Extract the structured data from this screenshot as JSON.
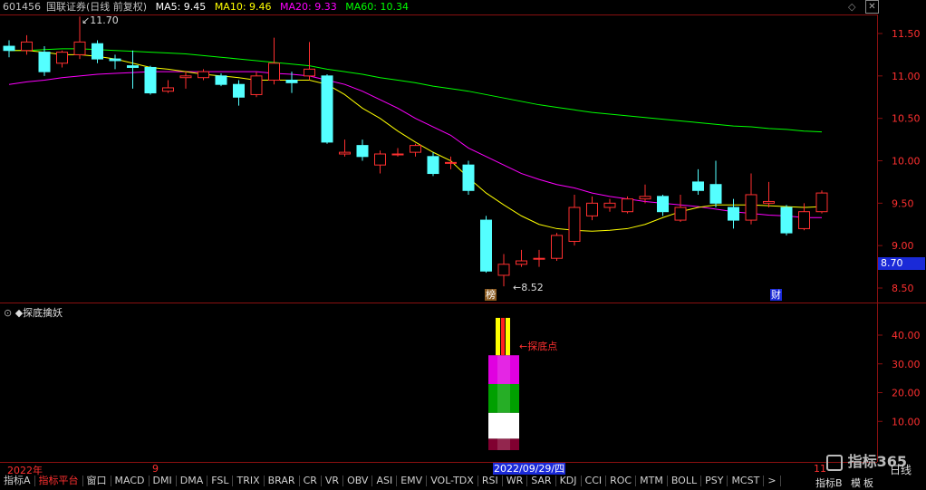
{
  "header": {
    "symbol": "601456",
    "name": "国联证券(日线 前复权)",
    "ma5_label": "MA5: 9.45",
    "ma10_label": "MA10: 9.46",
    "ma20_label": "MA20: 9.33",
    "ma60_label": "MA60: 10.34"
  },
  "colors": {
    "up": "#ff3030",
    "down": "#54ffff",
    "ma5": "#ffffff",
    "ma10": "#ffff00",
    "ma20": "#ff00ff",
    "ma60": "#00ff00",
    "axis": "#8a1010"
  },
  "price_axis": {
    "ticks": [
      "11.50",
      "11.00",
      "10.50",
      "10.00",
      "9.50",
      "9.00",
      "8.50"
    ],
    "current_price": "8.70"
  },
  "annotations": {
    "high": "11.70",
    "low": "8.52",
    "marker_bang": "榜",
    "marker_cai": "财"
  },
  "indicator": {
    "title": "◆探底擒妖",
    "signal_label": "探底点",
    "ticks": [
      "40.00",
      "30.00",
      "20.00",
      "10.00"
    ]
  },
  "time_axis": {
    "year": "2022年",
    "month": "9",
    "cursor_date": "2022/09/29/四",
    "right": "11"
  },
  "tabs": [
    "指标A",
    "指标平台",
    "窗口",
    "MACD",
    "DMI",
    "DMA",
    "FSL",
    "TRIX",
    "BRAR",
    "CR",
    "VR",
    "OBV",
    "ASI",
    "EMV",
    "VOL-TDX",
    "RSI",
    "WR",
    "SAR",
    "KDJ",
    "CCI",
    "ROC",
    "MTM",
    "BOLL",
    "PSY",
    "MCST",
    ">"
  ],
  "side_buttons": {
    "indicator_b": "指标B",
    "template": "模",
    "board": "板",
    "period": "日线"
  },
  "brand": "指标365",
  "chart_data": {
    "type": "candlestick",
    "candles": [
      {
        "o": 11.35,
        "c": 11.3,
        "h": 11.42,
        "l": 11.22
      },
      {
        "o": 11.3,
        "c": 11.4,
        "h": 11.48,
        "l": 11.25
      },
      {
        "o": 11.28,
        "c": 11.05,
        "h": 11.35,
        "l": 11.0
      },
      {
        "o": 11.15,
        "c": 11.28,
        "h": 11.3,
        "l": 11.1
      },
      {
        "o": 11.25,
        "c": 11.4,
        "h": 11.7,
        "l": 11.2
      },
      {
        "o": 11.38,
        "c": 11.2,
        "h": 11.42,
        "l": 11.15
      },
      {
        "o": 11.2,
        "c": 11.18,
        "h": 11.25,
        "l": 11.08
      },
      {
        "o": 11.12,
        "c": 11.1,
        "h": 11.3,
        "l": 10.85
      },
      {
        "o": 11.1,
        "c": 10.8,
        "h": 11.12,
        "l": 10.78
      },
      {
        "o": 10.82,
        "c": 10.86,
        "h": 10.95,
        "l": 10.8
      },
      {
        "o": 10.98,
        "c": 11.0,
        "h": 11.05,
        "l": 10.85
      },
      {
        "o": 10.98,
        "c": 11.05,
        "h": 11.08,
        "l": 10.95
      },
      {
        "o": 11.0,
        "c": 10.9,
        "h": 11.03,
        "l": 10.88
      },
      {
        "o": 10.9,
        "c": 10.75,
        "h": 10.95,
        "l": 10.65
      },
      {
        "o": 10.78,
        "c": 11.0,
        "h": 11.05,
        "l": 10.75
      },
      {
        "o": 10.95,
        "c": 11.15,
        "h": 11.45,
        "l": 10.9
      },
      {
        "o": 10.95,
        "c": 10.92,
        "h": 11.05,
        "l": 10.8
      },
      {
        "o": 11.0,
        "c": 11.08,
        "h": 11.4,
        "l": 10.95
      },
      {
        "o": 11.0,
        "c": 10.22,
        "h": 11.02,
        "l": 10.2
      },
      {
        "o": 10.08,
        "c": 10.1,
        "h": 10.25,
        "l": 10.05
      },
      {
        "o": 10.18,
        "c": 10.05,
        "h": 10.25,
        "l": 10.0
      },
      {
        "o": 9.95,
        "c": 10.08,
        "h": 10.12,
        "l": 9.85
      },
      {
        "o": 10.08,
        "c": 10.08,
        "h": 10.15,
        "l": 10.05
      },
      {
        "o": 10.1,
        "c": 10.18,
        "h": 10.2,
        "l": 10.05
      },
      {
        "o": 10.05,
        "c": 9.85,
        "h": 10.1,
        "l": 9.82
      },
      {
        "o": 9.98,
        "c": 9.98,
        "h": 10.05,
        "l": 9.9
      },
      {
        "o": 9.95,
        "c": 9.65,
        "h": 10.0,
        "l": 9.6
      },
      {
        "o": 9.3,
        "c": 8.7,
        "h": 9.35,
        "l": 8.68
      },
      {
        "o": 8.65,
        "c": 8.78,
        "h": 8.9,
        "l": 8.52
      },
      {
        "o": 8.78,
        "c": 8.82,
        "h": 8.95,
        "l": 8.75
      },
      {
        "o": 8.85,
        "c": 8.85,
        "h": 8.95,
        "l": 8.75
      },
      {
        "o": 8.85,
        "c": 9.12,
        "h": 9.15,
        "l": 8.82
      },
      {
        "o": 9.05,
        "c": 9.45,
        "h": 9.6,
        "l": 9.0
      },
      {
        "o": 9.35,
        "c": 9.5,
        "h": 9.58,
        "l": 9.3
      },
      {
        "o": 9.45,
        "c": 9.5,
        "h": 9.55,
        "l": 9.4
      },
      {
        "o": 9.4,
        "c": 9.55,
        "h": 9.58,
        "l": 9.38
      },
      {
        "o": 9.55,
        "c": 9.58,
        "h": 9.72,
        "l": 9.5
      },
      {
        "o": 9.58,
        "c": 9.4,
        "h": 9.6,
        "l": 9.35
      },
      {
        "o": 9.3,
        "c": 9.45,
        "h": 9.6,
        "l": 9.28
      },
      {
        "o": 9.75,
        "c": 9.65,
        "h": 9.9,
        "l": 9.6
      },
      {
        "o": 9.72,
        "c": 9.5,
        "h": 10.0,
        "l": 9.45
      },
      {
        "o": 9.45,
        "c": 9.3,
        "h": 9.55,
        "l": 9.2
      },
      {
        "o": 9.3,
        "c": 9.6,
        "h": 9.85,
        "l": 9.25
      },
      {
        "o": 9.5,
        "c": 9.52,
        "h": 9.75,
        "l": 9.45
      },
      {
        "o": 9.45,
        "c": 9.15,
        "h": 9.48,
        "l": 9.12
      },
      {
        "o": 9.2,
        "c": 9.4,
        "h": 9.5,
        "l": 9.18
      },
      {
        "o": 9.4,
        "c": 9.62,
        "h": 9.65,
        "l": 9.38
      }
    ],
    "ma5": [
      11.35,
      11.33,
      11.3,
      11.28,
      11.3,
      11.25,
      11.2,
      11.15,
      11.05,
      10.98,
      10.95,
      10.92,
      10.92,
      10.93,
      10.95,
      10.95,
      10.95,
      10.98,
      10.85,
      10.6,
      10.35,
      10.2,
      10.1,
      10.08,
      10.02,
      9.95,
      9.7,
      9.4,
      9.15,
      8.95,
      8.9,
      8.98,
      9.05,
      9.15,
      9.25,
      9.35,
      9.45,
      9.5,
      9.48,
      9.45,
      9.42,
      9.38,
      9.4,
      9.42,
      9.4,
      9.4,
      9.45
    ],
    "ma10": [
      11.3,
      11.3,
      11.28,
      11.25,
      11.25,
      11.23,
      11.2,
      11.15,
      11.1,
      11.08,
      11.05,
      11.02,
      11.0,
      10.98,
      10.95,
      10.95,
      10.95,
      10.95,
      10.9,
      10.78,
      10.62,
      10.5,
      10.35,
      10.22,
      10.1,
      10.0,
      9.8,
      9.62,
      9.48,
      9.35,
      9.25,
      9.2,
      9.18,
      9.17,
      9.18,
      9.2,
      9.25,
      9.33,
      9.4,
      9.45,
      9.48,
      9.48,
      9.48,
      9.47,
      9.46,
      9.45,
      9.46
    ],
    "ma20": [
      10.9,
      10.93,
      10.95,
      10.98,
      11.0,
      11.02,
      11.03,
      11.04,
      11.05,
      11.05,
      11.05,
      11.05,
      11.05,
      11.05,
      11.05,
      11.03,
      11.02,
      11.0,
      10.95,
      10.9,
      10.82,
      10.72,
      10.62,
      10.5,
      10.4,
      10.3,
      10.15,
      10.05,
      9.95,
      9.85,
      9.78,
      9.72,
      9.68,
      9.62,
      9.58,
      9.55,
      9.52,
      9.5,
      9.48,
      9.46,
      9.43,
      9.4,
      9.38,
      9.36,
      9.35,
      9.33,
      9.33
    ],
    "ma60": [
      11.3,
      11.3,
      11.31,
      11.32,
      11.32,
      11.31,
      11.3,
      11.29,
      11.28,
      11.27,
      11.26,
      11.24,
      11.22,
      11.2,
      11.18,
      11.16,
      11.14,
      11.12,
      11.08,
      11.05,
      11.02,
      10.98,
      10.95,
      10.92,
      10.88,
      10.85,
      10.82,
      10.78,
      10.74,
      10.7,
      10.66,
      10.63,
      10.6,
      10.57,
      10.55,
      10.53,
      10.51,
      10.49,
      10.47,
      10.45,
      10.43,
      10.41,
      10.4,
      10.38,
      10.37,
      10.35,
      10.34
    ]
  }
}
